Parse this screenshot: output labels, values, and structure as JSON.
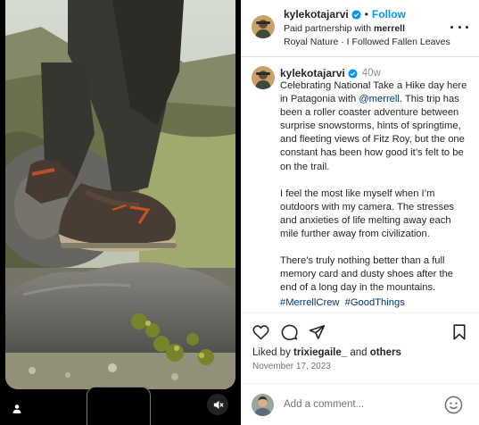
{
  "post": {
    "author": "kylekotajarvi",
    "follow_label": "Follow",
    "dot": "•",
    "partnership_prefix": "Paid partnership with",
    "partner": "merrell",
    "audio": "Royal Nature · I Followed Fallen Leaves",
    "age": "40w",
    "caption": {
      "p1_before": "Celebrating National Take a Hike day here in Patagonia with ",
      "p1_mention": "@merrell",
      "p1_after": ". This trip has been a roller coaster adventure between surprise snowstorms, hints of springtime, and fleeting views of Fitz Roy, but the one constant has been how good it’s felt to be on the trail.",
      "p2": "I feel the most like myself when I’m outdoors with my camera. The stresses and anxieties of life melting away each mile further away from civilization.",
      "p3": "There’s truly nothing better than a full memory card and dusty shoes after the end of a long day in the mountains."
    },
    "hashtags": [
      "#MerrellCrew",
      "#GoodThings"
    ],
    "liked_by_prefix": "Liked by",
    "liked_by_user": "trixiegaile_",
    "liked_by_joiner": "and",
    "liked_by_suffix": "others",
    "date": "November 17, 2023"
  },
  "comment": {
    "placeholder": "Add a comment..."
  },
  "icons": {
    "verified": "verified-badge-icon",
    "more": "more-options-icon",
    "like": "heart-icon",
    "comment": "comment-bubble-icon",
    "share": "paper-plane-icon",
    "save": "bookmark-icon",
    "emoji": "smiley-icon",
    "user_tag": "user-tag-icon",
    "mute": "speaker-muted-icon"
  },
  "colors": {
    "link_blue": "#0095f6",
    "hashtag": "#00376b",
    "text": "#262626",
    "muted": "#8e8e8e"
  }
}
